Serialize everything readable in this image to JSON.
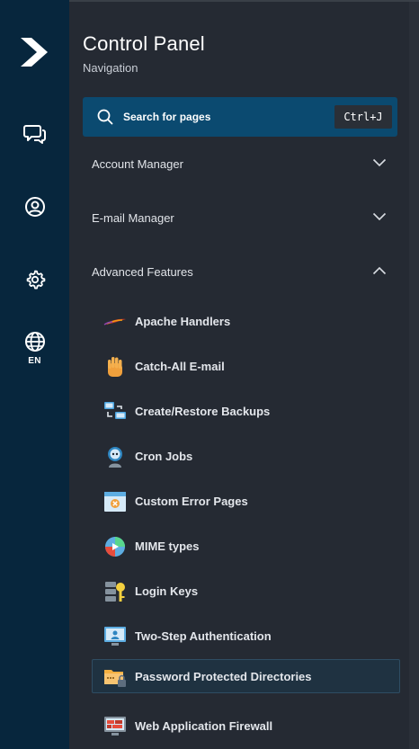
{
  "rail": {
    "items": [
      {
        "icon": "logo-arrow-icon"
      },
      {
        "icon": "chat-bubbles-icon"
      },
      {
        "icon": "user-circle-icon"
      },
      {
        "icon": "gear-icon"
      },
      {
        "icon": "globe-icon",
        "label": "EN"
      }
    ]
  },
  "panel": {
    "title": "Control Panel",
    "subtitle": "Navigation"
  },
  "search": {
    "placeholder": "Search for pages",
    "shortcut": "Ctrl+J"
  },
  "sections": [
    {
      "label": "Account Manager",
      "expanded": false
    },
    {
      "label": "E-mail Manager",
      "expanded": false
    },
    {
      "label": "Advanced Features",
      "expanded": true
    }
  ],
  "advanced_items": [
    {
      "label": "Apache Handlers",
      "icon": "apache-feather-icon"
    },
    {
      "label": "Catch-All E-mail",
      "icon": "hand-icon"
    },
    {
      "label": "Create/Restore Backups",
      "icon": "backup-computers-icon"
    },
    {
      "label": "Cron Jobs",
      "icon": "robot-icon"
    },
    {
      "label": "Custom Error Pages",
      "icon": "error-page-icon"
    },
    {
      "label": "MIME types",
      "icon": "media-globe-icon"
    },
    {
      "label": "Login Keys",
      "icon": "key-server-icon"
    },
    {
      "label": "Two-Step Authentication",
      "icon": "monitor-user-icon"
    },
    {
      "label": "Password Protected Directories",
      "icon": "locked-folder-icon",
      "active": true
    },
    {
      "label": "Web Application Firewall",
      "icon": "firewall-monitor-icon"
    }
  ],
  "colors": {
    "rail_bg": "#07263d",
    "panel_bg": "#252a33",
    "search_bg": "#0b4a70",
    "active_item_bg": "#1f3241"
  }
}
